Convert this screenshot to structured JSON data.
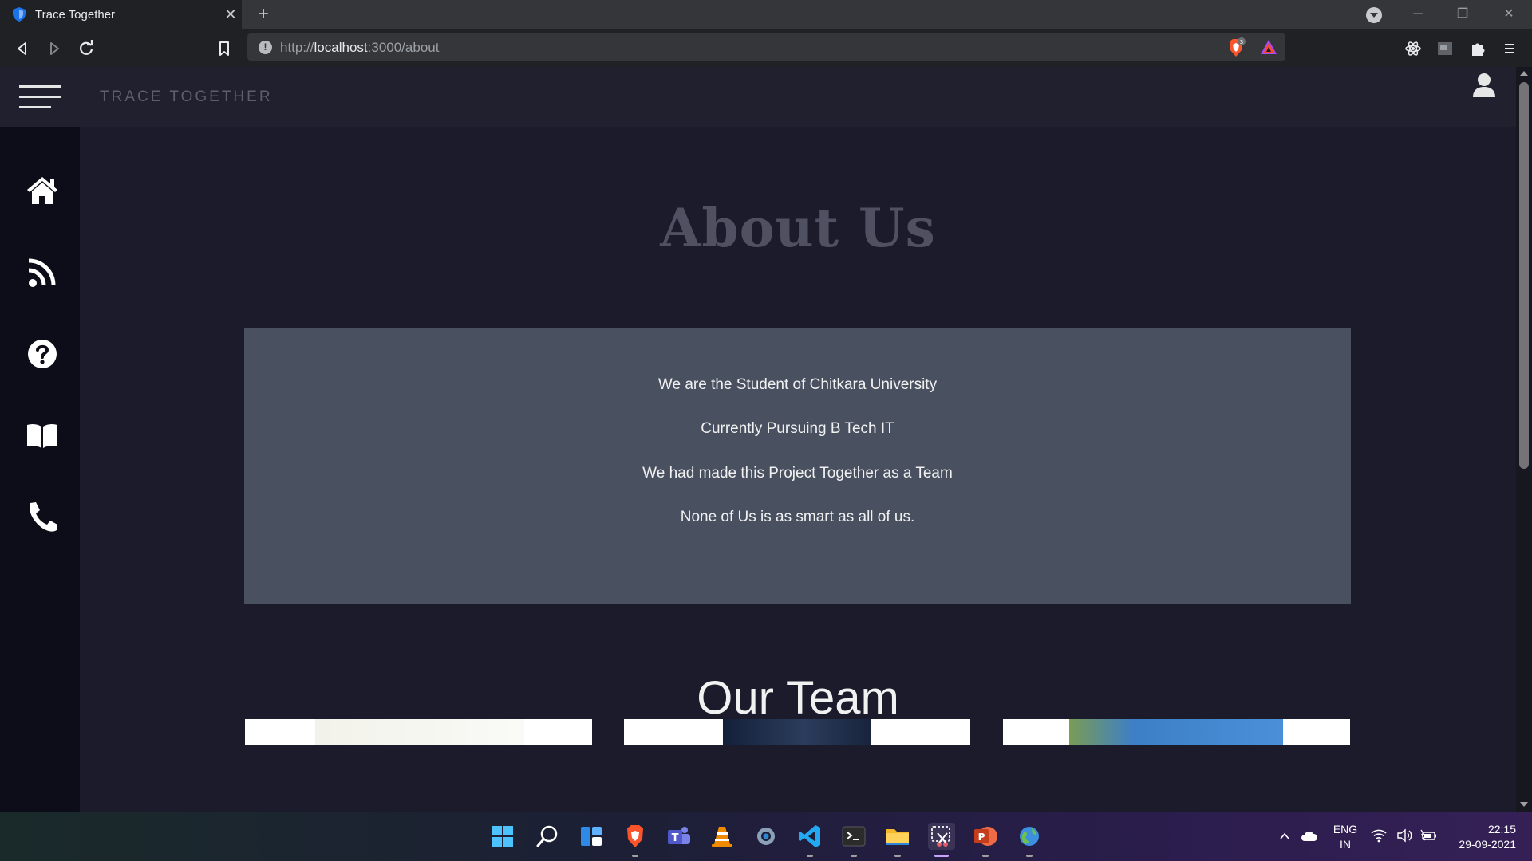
{
  "browser": {
    "tab_title": "Trace Together",
    "url_scheme": "http://",
    "url_host": "localhost",
    "url_rest": ":3000/about",
    "shield_badge": "3"
  },
  "header": {
    "brand": "TRACE TOGETHER"
  },
  "sidebar": {
    "items": [
      {
        "icon": "home-icon"
      },
      {
        "icon": "rss-feed-icon"
      },
      {
        "icon": "question-circle-icon"
      },
      {
        "icon": "book-open-icon"
      },
      {
        "icon": "phone-icon"
      }
    ]
  },
  "about": {
    "title": "About Us",
    "lines": [
      "We are the Student of Chitkara University",
      "Currently Pursuing B Tech IT",
      "We had made this Project Together as a Team",
      "None of Us is as smart as all of us."
    ]
  },
  "team": {
    "title": "Our Team"
  },
  "taskbar": {
    "lang_line1": "ENG",
    "lang_line2": "IN",
    "time": "22:15",
    "date": "29-09-2021"
  },
  "colors": {
    "page_bg": "#1b1b2b",
    "header_bg": "#20202e",
    "sidebar_bg": "#0d0d19",
    "about_box_bg": "#495060",
    "title_muted": "#4f5162"
  }
}
